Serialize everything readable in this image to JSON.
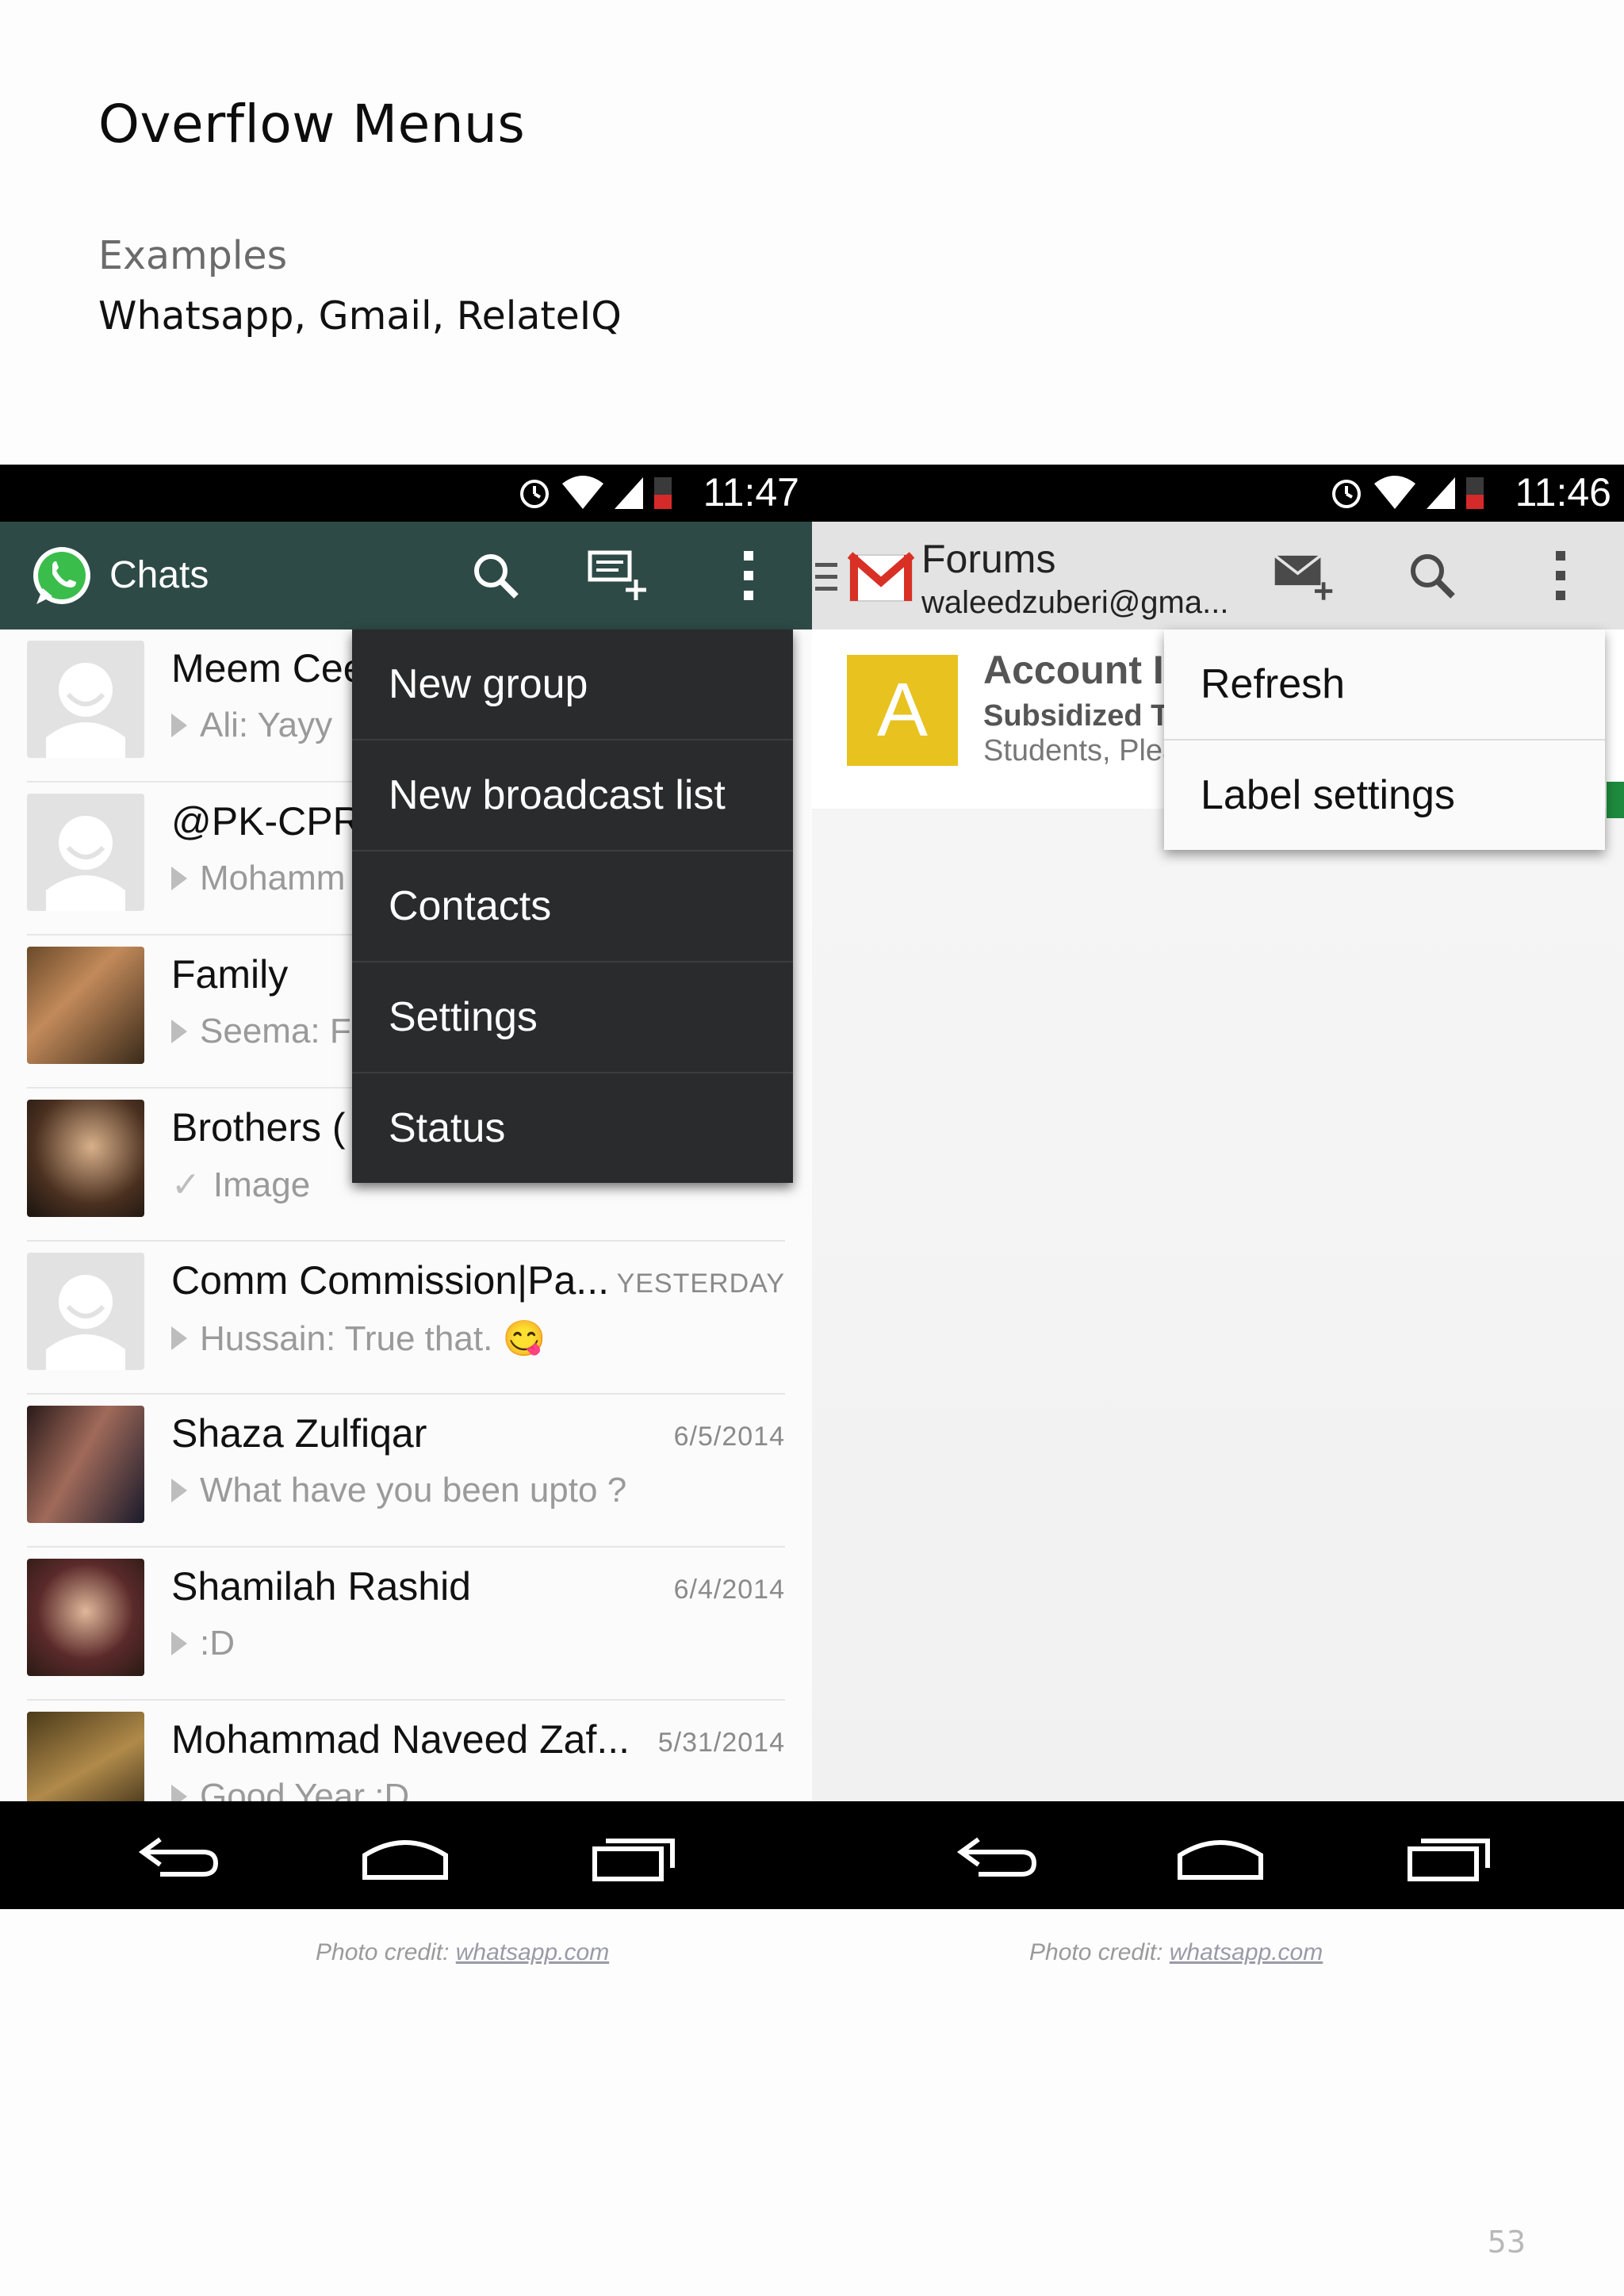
{
  "slide": {
    "title": "Overflow Menus",
    "subtitle": "Examples",
    "apps_line": "Whatsapp, Gmail, RelateIQ",
    "page_number": "53"
  },
  "whatsapp": {
    "time": "11:47",
    "title": "Chats",
    "menu_items": [
      "New group",
      "New broadcast list",
      "Contacts",
      "Settings",
      "Status"
    ],
    "chats": [
      {
        "name": "Meem Cee",
        "date": "",
        "preview": "Ali: Yayy",
        "marker": "arrow"
      },
      {
        "name": "@PK-CPR",
        "date": "",
        "preview": "Mohamm",
        "marker": "arrow"
      },
      {
        "name": "Family",
        "date": "",
        "preview": "Seema: F",
        "marker": "arrow"
      },
      {
        "name": "Brothers (",
        "date": "",
        "preview": "Image",
        "marker": "check"
      },
      {
        "name": "Comm Commission|Pa...",
        "date": "YESTERDAY",
        "preview": "Hussain: True that. 😋",
        "marker": "arrow"
      },
      {
        "name": "Shaza Zulfiqar",
        "date": "6/5/2014",
        "preview": "What have you been upto ?",
        "marker": "arrow"
      },
      {
        "name": "Shamilah Rashid",
        "date": "6/4/2014",
        "preview": ":D",
        "marker": "arrow"
      },
      {
        "name": "Mohammad Naveed Zaf...",
        "date": "5/31/2014",
        "preview": "Good Year :D",
        "marker": "arrow"
      }
    ],
    "credit_prefix": "Photo credit: ",
    "credit_link": "whatsapp.com"
  },
  "gmail": {
    "time": "11:46",
    "title": "Forums",
    "account": "waleedzuberi@gma...",
    "item": {
      "letter": "A",
      "subject": "Account In",
      "subject2": "Subsidized Tr",
      "snippet": "Students, Plea"
    },
    "menu_items": [
      "Refresh",
      "Label settings"
    ],
    "credit_prefix": "Photo credit: ",
    "credit_link": "whatsapp.com"
  },
  "colors": {
    "whatsapp_bar": "#2d4a46",
    "whatsapp_menu": "#2a2b2c",
    "gmail_bar": "#e3e3e3",
    "gmail_letter_tile": "#e8c21f"
  }
}
